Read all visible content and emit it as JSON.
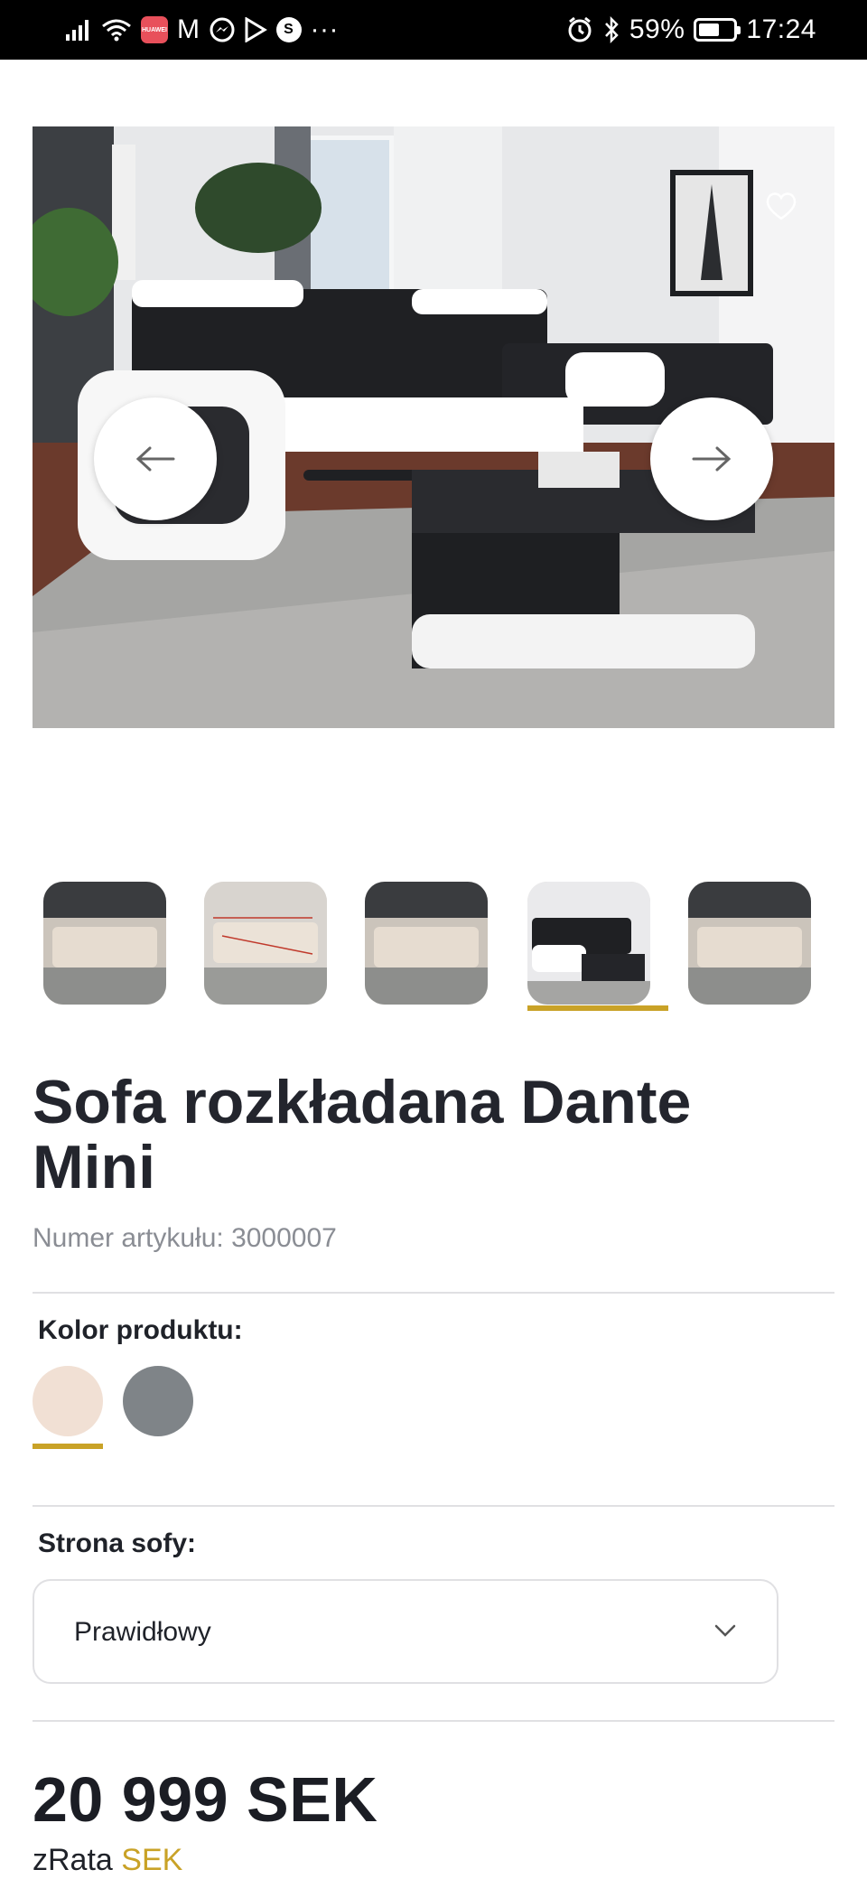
{
  "status_bar": {
    "mail_icon_text": "M",
    "app_icon_text": "HUAWEI",
    "more": "···",
    "battery": "59%",
    "battery_level": 0.59,
    "time": "17:24"
  },
  "gallery": {
    "prev_icon": "arrow-left-icon",
    "next_icon": "arrow-right-icon",
    "wishlist_icon": "heart-icon",
    "thumbnail_count": 5,
    "selected_thumbnail": 4
  },
  "product": {
    "title": "Sofa rozkładana Dante Mini",
    "sku": "Numer artykułu: 3000007",
    "color_label": "Kolor produktu:",
    "colors": [
      "#f1e0d4",
      "#7f8488"
    ],
    "selected_color": 1,
    "side_label": "Strona sofy:",
    "side_value": "Prawidłowy",
    "price": "20 999  SEK",
    "rata_prefix": "zRata",
    "rata_currency": "SEK"
  },
  "colors": {
    "accent": "#c9a227",
    "text": "#1f2229",
    "muted": "#8a8d94",
    "divider": "#e0e0e3"
  }
}
